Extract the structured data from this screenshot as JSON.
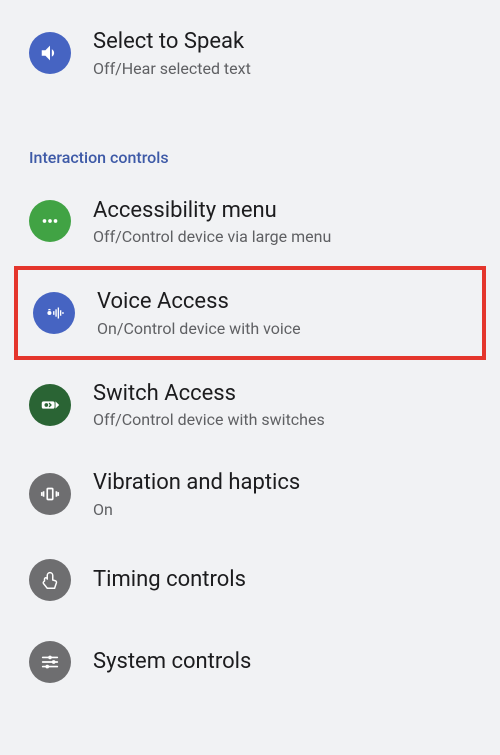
{
  "items": {
    "select_to_speak": {
      "title": "Select to Speak",
      "subtitle": "Off/Hear selected text"
    },
    "accessibility_menu": {
      "title": "Accessibility menu",
      "subtitle": "Off/Control device via large menu"
    },
    "voice_access": {
      "title": "Voice Access",
      "subtitle": "On/Control device with voice"
    },
    "switch_access": {
      "title": "Switch Access",
      "subtitle": "Off/Control device with switches"
    },
    "vibration": {
      "title": "Vibration and haptics",
      "subtitle": "On"
    },
    "timing": {
      "title": "Timing controls"
    },
    "system": {
      "title": "System controls"
    }
  },
  "section_header": "Interaction controls"
}
